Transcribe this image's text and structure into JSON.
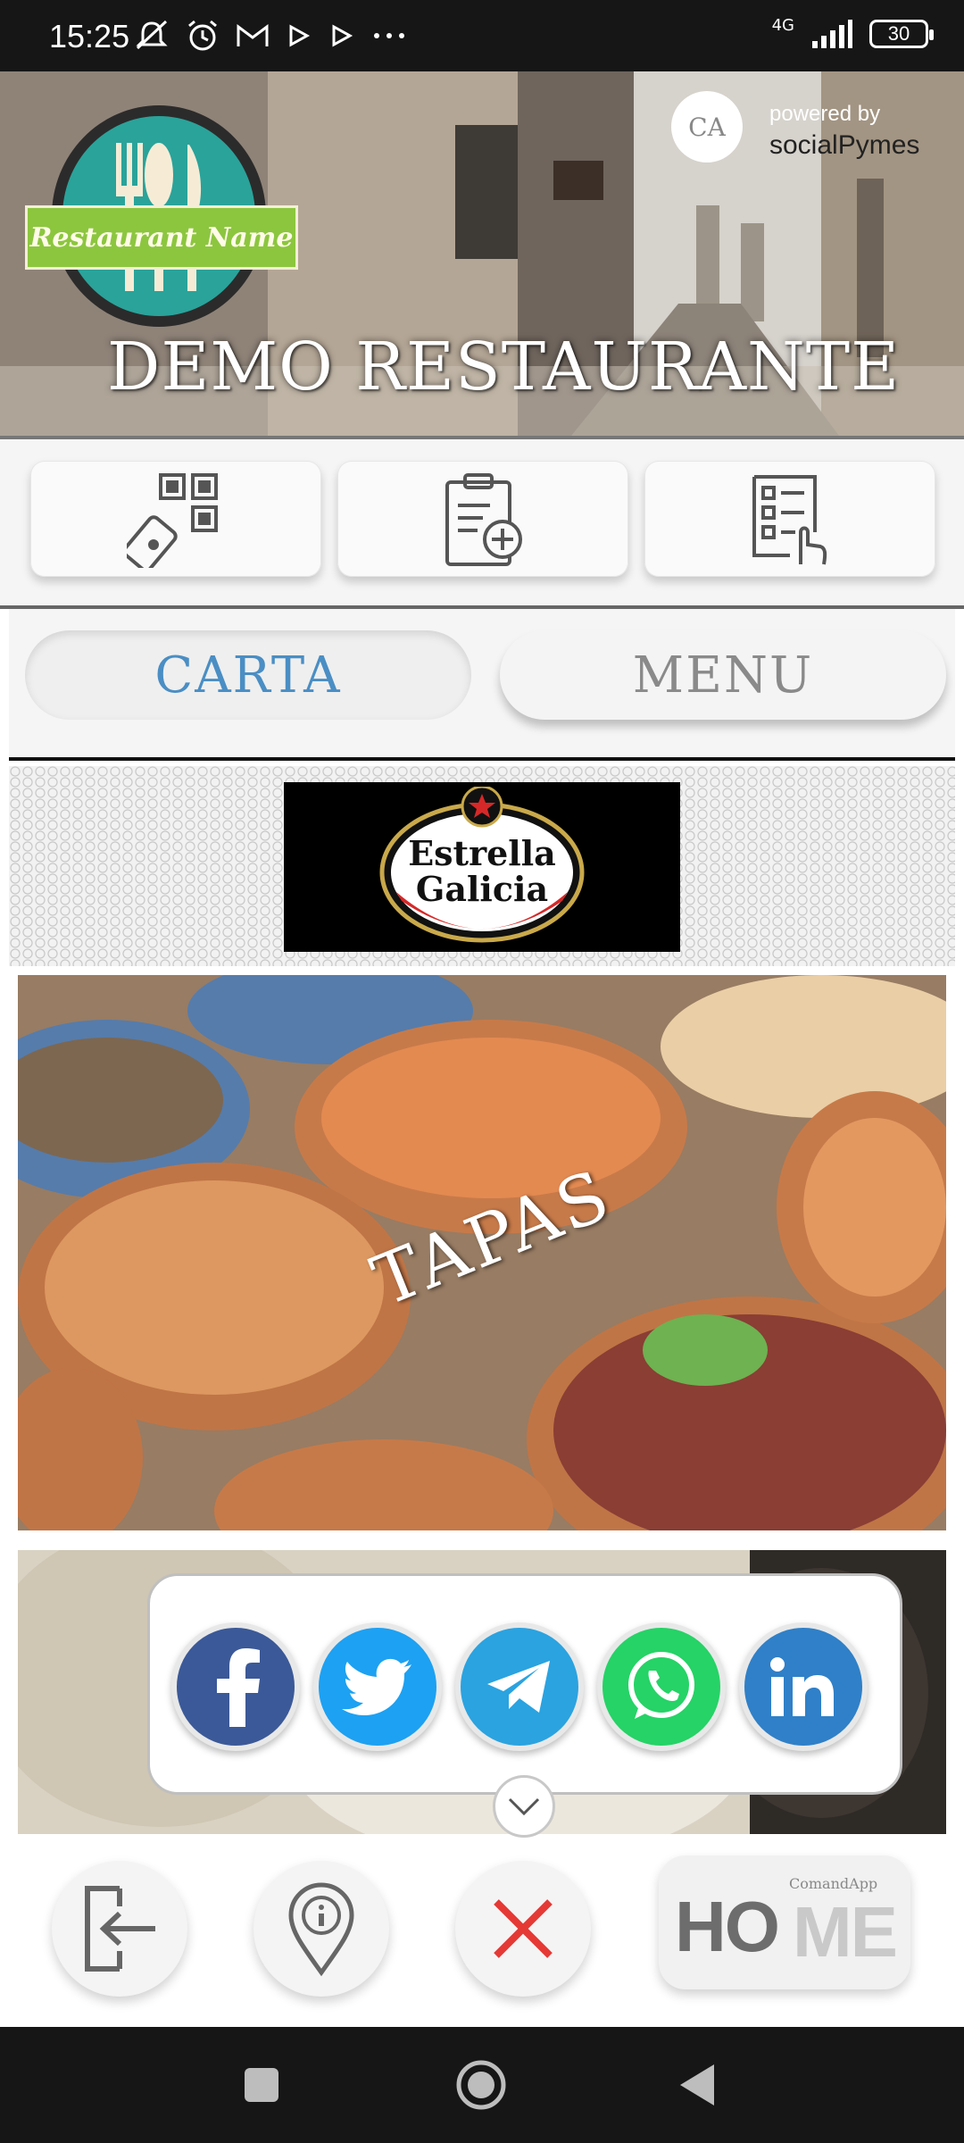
{
  "status_bar": {
    "time": "15:25",
    "network": "4G",
    "battery": "30"
  },
  "header": {
    "logo_text": "Restaurant Name",
    "title": "DEMO RESTAURANTE",
    "powered_by": "powered by",
    "powered_brand": "socialPymes",
    "badge_text": "CA"
  },
  "quick_actions": [
    {
      "name": "qr-scan-icon"
    },
    {
      "name": "clipboard-add-icon"
    },
    {
      "name": "checklist-icon"
    }
  ],
  "tabs": {
    "carta": "CARTA",
    "menu": "MENU"
  },
  "sponsor": {
    "line1": "Estrella",
    "line2": "Galicia"
  },
  "categories": [
    {
      "label": "TAPAS"
    }
  ],
  "share": [
    "facebook-icon",
    "twitter-icon",
    "telegram-icon",
    "whatsapp-icon",
    "linkedin-icon"
  ],
  "bottom_nav": {
    "home_ho": "HO",
    "home_me": "ME",
    "home_sub": "ComandApp"
  },
  "colors": {
    "accent": "#4a8ec4",
    "facebook": "#3b5998",
    "twitter": "#1da1f2",
    "telegram": "#2aa3e0",
    "whatsapp": "#25d366",
    "linkedin": "#2f80c8",
    "close": "#e53935"
  }
}
